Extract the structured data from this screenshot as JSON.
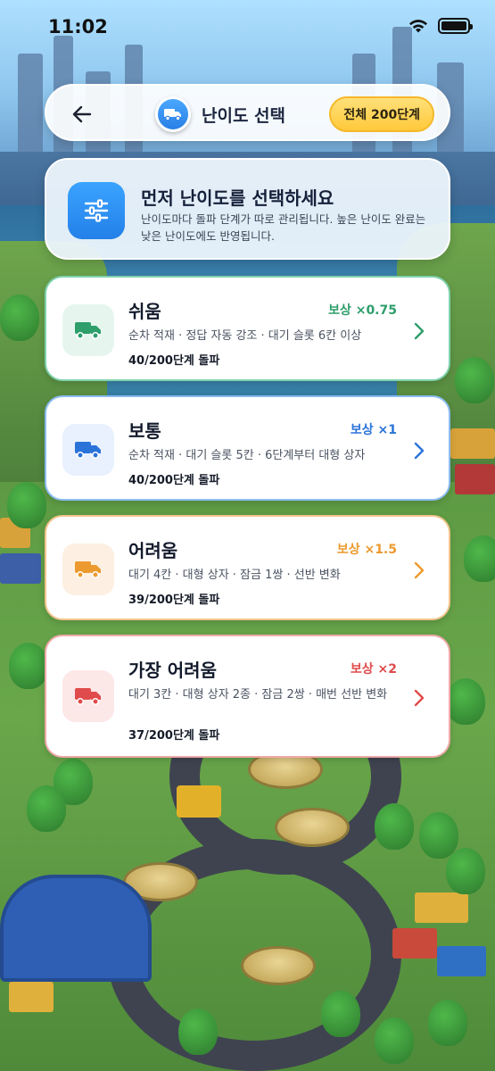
{
  "status_bar": {
    "time": "11:02",
    "icons": [
      "wifi-icon",
      "battery-icon"
    ]
  },
  "header": {
    "back_icon": "arrow-left-icon",
    "title_icon": "truck-icon",
    "title": "난이도 선택",
    "total_badge": "전체 200단계"
  },
  "info_card": {
    "icon": "sliders-icon",
    "title": "먼저 난이도를 선택하세요",
    "description": "난이도마다 돌파 단계가 따로 관리됩니다. 높은 난이도 완료는 낮은 난이도에도 반영됩니다."
  },
  "levels": [
    {
      "name": "쉬움",
      "reward": "보상 ×0.75",
      "description": "순차 적재 · 정답 자동 강조 · 대기 슬롯 6칸 이상",
      "progress": "40/200단계 돌파",
      "accent": "#2e9e6a",
      "icon_bg": "#e6f6ee",
      "border": "#7fd1ae",
      "icon": "truck-icon"
    },
    {
      "name": "보통",
      "reward": "보상 ×1",
      "description": "순차 적재 · 대기 슬롯 5칸 · 6단계부터 대형 상자",
      "progress": "40/200단계 돌파",
      "accent": "#2a74d9",
      "icon_bg": "#e8f1fd",
      "border": "#8bbcf0",
      "icon": "truck-icon"
    },
    {
      "name": "어려움",
      "reward": "보상 ×1.5",
      "description": "대기 4칸 · 대형 상자 · 잠금 1쌍 · 선반 변화",
      "progress": "39/200단계 돌파",
      "accent": "#ec9a2f",
      "icon_bg": "#fdf0e2",
      "border": "#f2c48d",
      "icon": "truck-icon"
    },
    {
      "name": "가장 어려움",
      "reward": "보상 ×2",
      "description": "대기 3칸 · 대형 상자 2종 · 잠금 2쌍 · 매번 선반 변화",
      "progress": "37/200단계 돌파",
      "accent": "#e04b4b",
      "icon_bg": "#fde8e8",
      "border": "#f0a9a9",
      "icon": "truck-icon"
    }
  ]
}
